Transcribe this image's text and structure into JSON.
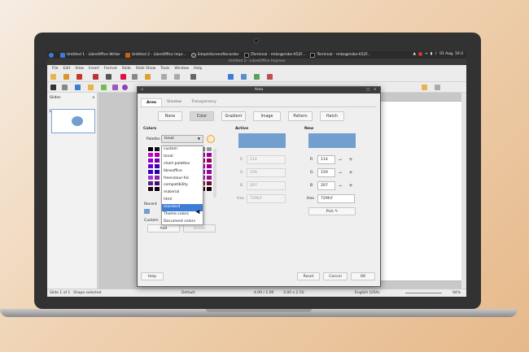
{
  "taskbar": {
    "tasks": [
      {
        "label": "Untitled 1 - LibreOffice Writer",
        "color": "#3d7dd8"
      },
      {
        "label": "Untitled 2 - LibreOffice Impr...",
        "color": "#d06010"
      },
      {
        "label": "SimpleScreenRecorder",
        "color": "#444444"
      },
      {
        "label": "[Terminal - mike@mike-X52F...",
        "color": "#333333"
      },
      {
        "label": "Terminal - mike@mike-X52F...",
        "color": "#333333"
      }
    ],
    "clock": "01 Aug, 10:3"
  },
  "window": {
    "title": "Untitled 2 - LibreOffice Impress"
  },
  "menu": [
    "File",
    "Edit",
    "View",
    "Insert",
    "Format",
    "Slide",
    "Slide Show",
    "Tools",
    "Window",
    "Help"
  ],
  "slides_panel": {
    "title": "Slides",
    "slide_number": "1"
  },
  "status": {
    "slide": "Slide 1 of 1",
    "selection": "Shape selected",
    "layout": "Default",
    "position": "4.00 / 2.00",
    "size": "3.00 x 2.50",
    "language": "English (USA)",
    "zoom": "94%"
  },
  "dialog": {
    "title": "Area",
    "tabs": [
      "Area",
      "Shadow",
      "Transparency"
    ],
    "type_buttons": [
      "None",
      "Color",
      "Gradient",
      "Image",
      "Pattern",
      "Hatch"
    ],
    "colors_heading": "Colors",
    "palette_label": "Palette:",
    "palette_value": "tonal",
    "palette_options": [
      "custom",
      "tonal",
      "chart-palettes",
      "libreoffice",
      "freecolour-hlc",
      "compatibility",
      "material",
      "html",
      "standard",
      "Theme colors",
      "Document colors"
    ],
    "selected_palette": "standard",
    "recent_label": "Recent",
    "custom_label": "Custom",
    "add_label": "Add",
    "delete_label": "Delete",
    "active_heading": "Active",
    "new_heading": "New",
    "active": {
      "r": "114",
      "g": "159",
      "b": "207",
      "hex": "729fcf"
    },
    "new": {
      "r": "114",
      "g": "159",
      "b": "207",
      "hex": "729fcf"
    },
    "labels": {
      "r": "R",
      "g": "G",
      "b": "B",
      "hex": "Hex"
    },
    "pick_label": "Pick",
    "help_label": "Help",
    "reset_label": "Reset",
    "cancel_label": "Cancel",
    "ok_label": "OK",
    "color_preview": "#729fcf"
  }
}
